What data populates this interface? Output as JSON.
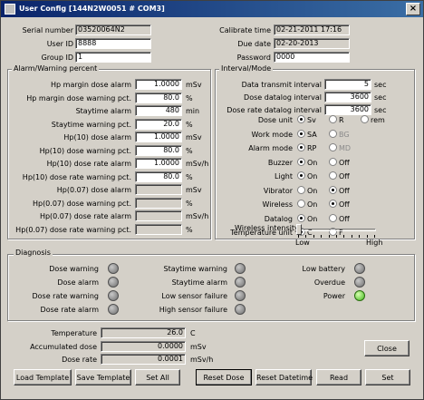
{
  "window": {
    "title": "User Config [144N2W0051 # COM3]"
  },
  "header": {
    "serial_label": "Serial number",
    "serial_value": "03520064N2",
    "userid_label": "User ID",
    "userid_value": "8888",
    "groupid_label": "Group ID",
    "groupid_value": "1",
    "calib_label": "Calibrate time",
    "calib_value": "02-21-2011 17:16",
    "due_label": "Due date",
    "due_value": "02-20-2013",
    "password_label": "Password",
    "password_value": "0000"
  },
  "alarm": {
    "title": "Alarm/Warning percent",
    "rows": [
      {
        "label": "Hp margin dose alarm",
        "value": "1.0000",
        "unit": "mSv"
      },
      {
        "label": "Hp margin dose warning pct.",
        "value": "80.0",
        "unit": "%"
      },
      {
        "label": "Staytime alarm",
        "value": "480",
        "unit": "min"
      },
      {
        "label": "Staytime warning pct.",
        "value": "20.0",
        "unit": "%"
      },
      {
        "label": "Hp(10) dose alarm",
        "value": "1.0000",
        "unit": "mSv"
      },
      {
        "label": "Hp(10) dose warning pct.",
        "value": "80.0",
        "unit": "%"
      },
      {
        "label": "Hp(10) dose rate alarm",
        "value": "1.0000",
        "unit": "mSv/h"
      },
      {
        "label": "Hp(10) dose rate warning pct.",
        "value": "80.0",
        "unit": "%"
      },
      {
        "label": "Hp(0.07) dose alarm",
        "value": "",
        "unit": "mSv"
      },
      {
        "label": "Hp(0.07) dose warning pct.",
        "value": "",
        "unit": "%"
      },
      {
        "label": "Hp(0.07) dose rate alarm",
        "value": "",
        "unit": "mSv/h"
      },
      {
        "label": "Hp(0.07) dose rate warning pct.",
        "value": "",
        "unit": "%"
      }
    ]
  },
  "interval": {
    "title": "Interval/Mode",
    "rows": [
      {
        "label": "Data transmit interval",
        "value": "5",
        "unit": "sec"
      },
      {
        "label": "Dose datalog interval",
        "value": "3600",
        "unit": "sec"
      },
      {
        "label": "Dose rate datalog interval",
        "value": "3600",
        "unit": "sec"
      }
    ],
    "modes": [
      {
        "label": "Dose unit",
        "options": [
          "Sv",
          "R",
          "rem"
        ],
        "selected": 0,
        "disabled": []
      },
      {
        "label": "Work mode",
        "options": [
          "SA",
          "BG"
        ],
        "selected": 0,
        "disabled": [
          1
        ]
      },
      {
        "label": "Alarm mode",
        "options": [
          "RP",
          "MD"
        ],
        "selected": 0,
        "disabled": [
          1
        ]
      },
      {
        "label": "Buzzer",
        "options": [
          "On",
          "Off"
        ],
        "selected": 0,
        "disabled": []
      },
      {
        "label": "Light",
        "options": [
          "On",
          "Off"
        ],
        "selected": 0,
        "disabled": []
      },
      {
        "label": "Vibrator",
        "options": [
          "On",
          "Off"
        ],
        "selected": 1,
        "disabled": []
      },
      {
        "label": "Wireless",
        "options": [
          "On",
          "Off"
        ],
        "selected": 1,
        "disabled": []
      },
      {
        "label": "Datalog",
        "options": [
          "On",
          "Off"
        ],
        "selected": 0,
        "disabled": []
      },
      {
        "label": "Temperature unit",
        "options": [
          "C",
          "F"
        ],
        "selected": 0,
        "disabled": []
      }
    ],
    "wireless_intensity_label": "Wireless intensity",
    "slider_low": "Low",
    "slider_high": "High",
    "slider_level": 0.0
  },
  "diagnosis": {
    "title": "Diagnosis",
    "col1": [
      {
        "label": "Dose warning",
        "on": false
      },
      {
        "label": "Dose alarm",
        "on": false
      },
      {
        "label": "Dose rate warning",
        "on": false
      },
      {
        "label": "Dose rate alarm",
        "on": false
      }
    ],
    "col2": [
      {
        "label": "Staytime warning",
        "on": false
      },
      {
        "label": "Staytime alarm",
        "on": false
      },
      {
        "label": "Low sensor failure",
        "on": false
      },
      {
        "label": "High sensor failure",
        "on": false
      }
    ],
    "col3": [
      {
        "label": "Low battery",
        "on": false
      },
      {
        "label": "Overdue",
        "on": false
      },
      {
        "label": "Power",
        "on": true
      }
    ]
  },
  "readings": [
    {
      "label": "Temperature",
      "value": "26.0",
      "unit": "C"
    },
    {
      "label": "Accumulated dose",
      "value": "0.0000",
      "unit": "mSv"
    },
    {
      "label": "Dose rate",
      "value": "0.0001",
      "unit": "mSv/h"
    }
  ],
  "buttons": {
    "close": "Close",
    "load_template": "Load Template",
    "save_template": "Save Template",
    "set_all": "Set All",
    "reset_dose": "Reset Dose",
    "reset_datetime": "Reset Datetime",
    "read": "Read",
    "set": "Set"
  },
  "colors": {
    "title_start": "#0a246a",
    "title_end": "#3a6ea5",
    "led_on": "#3fb81c",
    "led_off": "#8a8a8a"
  }
}
